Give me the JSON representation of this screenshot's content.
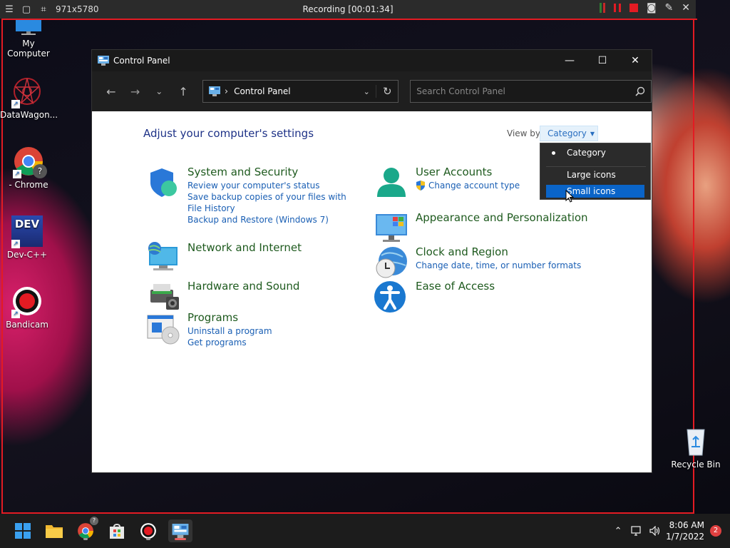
{
  "recorder": {
    "size_label": "971x5780",
    "title": "Recording [00:01:34]"
  },
  "desktop": {
    "icons": [
      {
        "label": "My Computer"
      },
      {
        "label": "DataWagon..."
      },
      {
        "label": "- Chrome"
      },
      {
        "label": "Dev-C++"
      },
      {
        "label": "Bandicam"
      },
      {
        "label": "Recycle Bin"
      }
    ],
    "dev_logo_text": "DEV",
    "chrome_badge": "?"
  },
  "window": {
    "title": "Control Panel",
    "address": "Control Panel",
    "search_placeholder": "Search Control Panel",
    "heading": "Adjust your computer's settings",
    "view_by_label": "View by:",
    "view_by_value": "Category",
    "categories_left": [
      {
        "title": "System and Security",
        "links": [
          "Review your computer's status",
          "Save backup copies of your files with File History",
          "Backup and Restore (Windows 7)"
        ]
      },
      {
        "title": "Network and Internet",
        "links": []
      },
      {
        "title": "Hardware and Sound",
        "links": []
      },
      {
        "title": "Programs",
        "links": [
          "Uninstall a program",
          "Get programs"
        ]
      }
    ],
    "categories_right": [
      {
        "title": "User Accounts",
        "links": [
          "Change account type"
        ]
      },
      {
        "title": "Appearance and Personalization",
        "links": []
      },
      {
        "title": "Clock and Region",
        "links": [
          "Change date, time, or number formats"
        ]
      },
      {
        "title": "Ease of Access",
        "links": []
      }
    ],
    "dropdown_options": [
      {
        "label": "Category",
        "checked": true,
        "selected": false
      },
      {
        "label": "Large icons",
        "checked": false,
        "selected": false
      },
      {
        "label": "Small icons",
        "checked": false,
        "selected": true
      }
    ]
  },
  "taskbar": {
    "time": "8:06 AM",
    "date": "1/7/2022",
    "notification_count": "2",
    "chrome_badge": "?"
  },
  "colors": {
    "accent": "#0a64c8",
    "link": "#1a5fb4",
    "category_title": "#1e5a1e",
    "heading": "#1e3287",
    "record_red": "#e31b23"
  }
}
